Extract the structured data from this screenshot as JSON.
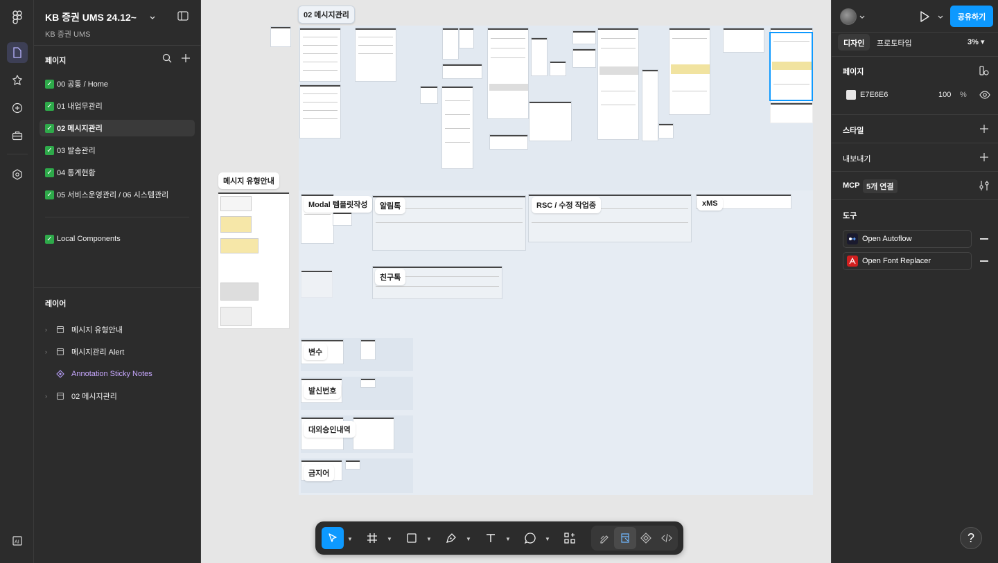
{
  "file": {
    "title": "KB 증권 UMS 24.12~",
    "subtitle": "KB 증권 UMS"
  },
  "pages": {
    "header": "페이지",
    "items": [
      {
        "label": "00 공통 / Home",
        "selected": false
      },
      {
        "label": "01 내업무관리",
        "selected": false
      },
      {
        "label": "02 메시지관리",
        "selected": true
      },
      {
        "label": "03 발송관리",
        "selected": false
      },
      {
        "label": "04 통계현황",
        "selected": false
      },
      {
        "label": "05 서비스운영관리 / 06 시스템관리",
        "selected": false
      },
      {
        "label": "Local Components",
        "selected": false
      }
    ],
    "check_glyph": "✓"
  },
  "layers": {
    "header": "레이어",
    "items": [
      {
        "label": "메시지 유형안내",
        "type": "frame"
      },
      {
        "label": "메시지관리 Alert",
        "type": "frame"
      },
      {
        "label": "Annotation Sticky Notes",
        "type": "component"
      },
      {
        "label": "02 메시지관리",
        "type": "frame"
      }
    ]
  },
  "canvas": {
    "labels": {
      "top_section": "02 메시지관리",
      "message_type_guide": "메시지 유형안내",
      "modal_template": "Modal 템플릿작성",
      "alimtalk": "알림톡",
      "rsc": "RSC / 수정 작업중",
      "xms": "xMS",
      "friendtalk": "친구톡",
      "variable": "변수",
      "sender_number": "발신번호",
      "external_approval": "대외승인내역",
      "banned_words": "금지어"
    },
    "section_color": "#e2e9f1",
    "selection_color": "#0d99ff"
  },
  "toolbar": {
    "tools": [
      "move-tool",
      "frame-tool",
      "shape-tool",
      "pen-tool",
      "text-tool",
      "comment-tool",
      "actions-tool"
    ],
    "active": "move-tool",
    "mode_tools": [
      "draw-mode",
      "design-mode",
      "component-mode",
      "dev-mode"
    ]
  },
  "right_panel": {
    "share_label": "공유하기",
    "tabs": [
      "디자인",
      "프로토타입"
    ],
    "zoom": "3%",
    "page_section": {
      "title": "페이지",
      "color_hex": "E7E6E6",
      "opacity": "100",
      "percent": "%"
    },
    "style_title": "스타일",
    "export_title": "내보내기",
    "mcp": {
      "title": "MCP",
      "badge": "5개 연결"
    },
    "tools_title": "도구",
    "plugins": [
      {
        "label": "Open Autoflow",
        "icon": "autoflow-icon",
        "color": "#1a1a2e"
      },
      {
        "label": "Open Font Replacer",
        "icon": "font-replacer-icon",
        "color": "#d11f1f"
      }
    ],
    "help": "?"
  }
}
